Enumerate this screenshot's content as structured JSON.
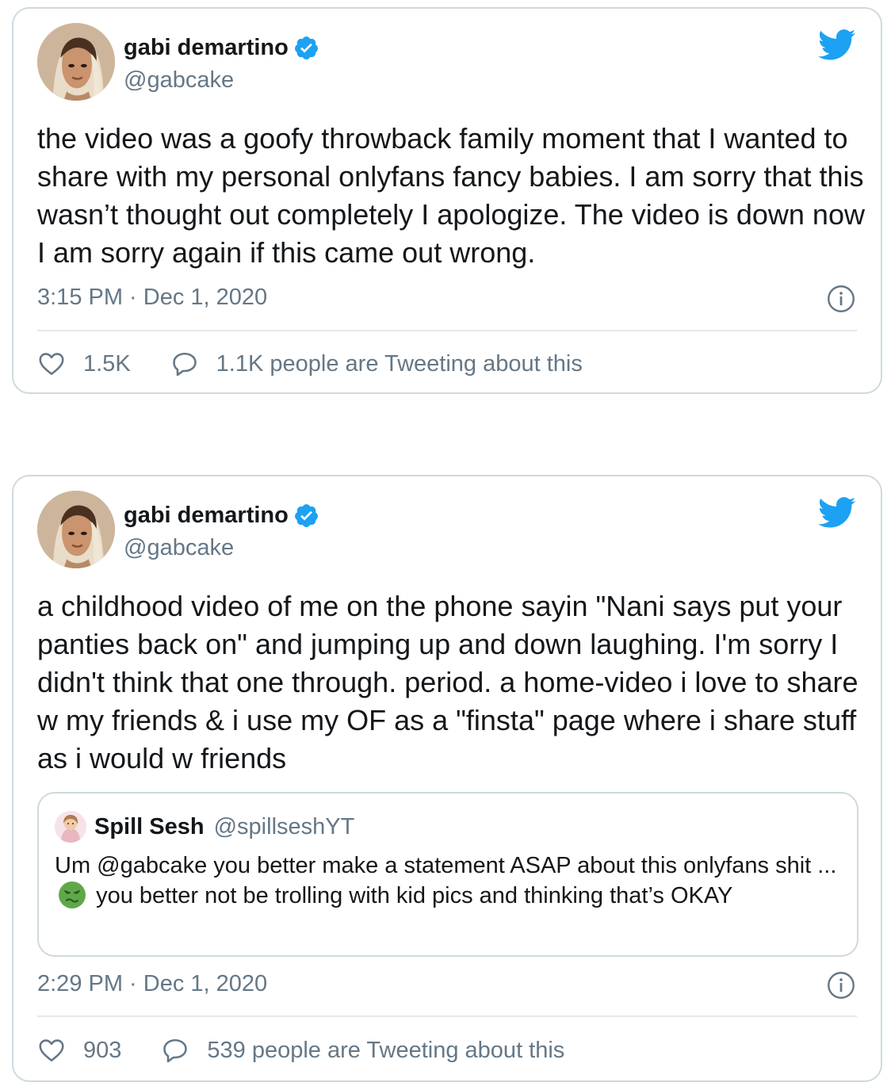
{
  "colors": {
    "text_primary": "#14171a",
    "text_secondary": "#657786",
    "twitter_blue": "#1da1f2",
    "border": "#cfd9de",
    "divider": "#e1e8ed"
  },
  "tweets": [
    {
      "author": {
        "display_name": "gabi demartino",
        "handle": "@gabcake",
        "verified": true,
        "avatar_icon": "profile-photo"
      },
      "text": "the video was a goofy throwback family moment that I wanted to share with my personal onlyfans fancy babies. I am sorry that this wasn’t thought out completely I apologize. The video is down now I am sorry again if this came out wrong.",
      "timestamp": "3:15 PM · Dec 1, 2020",
      "likes": "1.5K",
      "conversation": "1.1K people are Tweeting about this"
    },
    {
      "author": {
        "display_name": "gabi demartino",
        "handle": "@gabcake",
        "verified": true,
        "avatar_icon": "profile-photo"
      },
      "text": "a childhood video of me on the phone sayin \"Nani says put your panties back on\" and jumping up and down laughing. I'm sorry I didn't think that one through. period. a home-video i love to share w my friends & i use my OF as a \"finsta\" page where i share stuff as i would w friends",
      "quoted": {
        "display_name": "Spill Sesh",
        "handle": "@spillseshYT",
        "text_before_emoji": "Um @gabcake you better make a statement ASAP about this onlyfans shit ...",
        "emoji_icon": "nauseated-face-emoji",
        "text_after_emoji": "you better not be trolling with kid pics and thinking that’s OKAY"
      },
      "timestamp": "2:29 PM · Dec 1, 2020",
      "likes": "903",
      "conversation": "539 people are Tweeting about this"
    }
  ]
}
